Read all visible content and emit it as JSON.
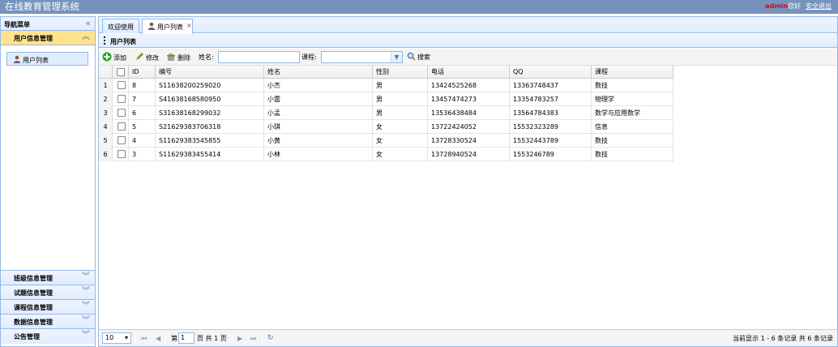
{
  "header": {
    "app_title": "在线教育管理系统",
    "user": "admin",
    "greeting": "您好",
    "logout": "安全退出"
  },
  "sidebar": {
    "title": "导航菜单",
    "sections": [
      {
        "label": "用户信息管理",
        "active": true,
        "items": [
          {
            "label": "用户列表"
          }
        ]
      },
      {
        "label": "班级信息管理"
      },
      {
        "label": "试题信息管理"
      },
      {
        "label": "课程信息管理"
      },
      {
        "label": "数据信息管理"
      },
      {
        "label": "公告管理"
      }
    ]
  },
  "tabs": [
    {
      "label": "欢迎使用"
    },
    {
      "label": "用户列表",
      "close": "×",
      "selected": true
    }
  ],
  "panel": {
    "title": "用户列表"
  },
  "toolbar": {
    "add": "添加",
    "edit": "修改",
    "delete": "删除",
    "name_label": "姓名:",
    "course_label": "课程:",
    "search": "搜索"
  },
  "grid": {
    "columns": [
      "ID",
      "编号",
      "姓名",
      "性别",
      "电话",
      "QQ",
      "课程"
    ],
    "rows": [
      {
        "n": "1",
        "id": "8",
        "code": "S11638200259020",
        "name": "小杰",
        "gender": "男",
        "phone": "13424525268",
        "qq": "13363748437",
        "course": "数技"
      },
      {
        "n": "2",
        "id": "7",
        "code": "S41638168580950",
        "name": "小雷",
        "gender": "男",
        "phone": "13457474273",
        "qq": "13354783257",
        "course": "物理学"
      },
      {
        "n": "3",
        "id": "6",
        "code": "S31638168299032",
        "name": "小孟",
        "gender": "男",
        "phone": "13536438484",
        "qq": "13564784383",
        "course": "数学与应用数学"
      },
      {
        "n": "4",
        "id": "5",
        "code": "S21629383706318",
        "name": "小琪",
        "gender": "女",
        "phone": "13722424052",
        "qq": "15532323289",
        "course": "信息"
      },
      {
        "n": "5",
        "id": "4",
        "code": "S11629383545855",
        "name": "小黄",
        "gender": "女",
        "phone": "13728330524",
        "qq": "15532443789",
        "course": "数技"
      },
      {
        "n": "6",
        "id": "3",
        "code": "S11629383455414",
        "name": "小林",
        "gender": "女",
        "phone": "13728940524",
        "qq": "1553246789",
        "course": "数技"
      }
    ]
  },
  "pager": {
    "page_size": "10",
    "page_prefix": "第",
    "page_value": "1",
    "page_suffix": "页 共 1 页",
    "summary": "当前显示 1 - 6 条记录 共 6 条记录"
  },
  "colors": {
    "header_bg": "#7593bd",
    "border": "#95b8e7",
    "active_section": "#ffe48d",
    "user_red": "#e8000b"
  }
}
